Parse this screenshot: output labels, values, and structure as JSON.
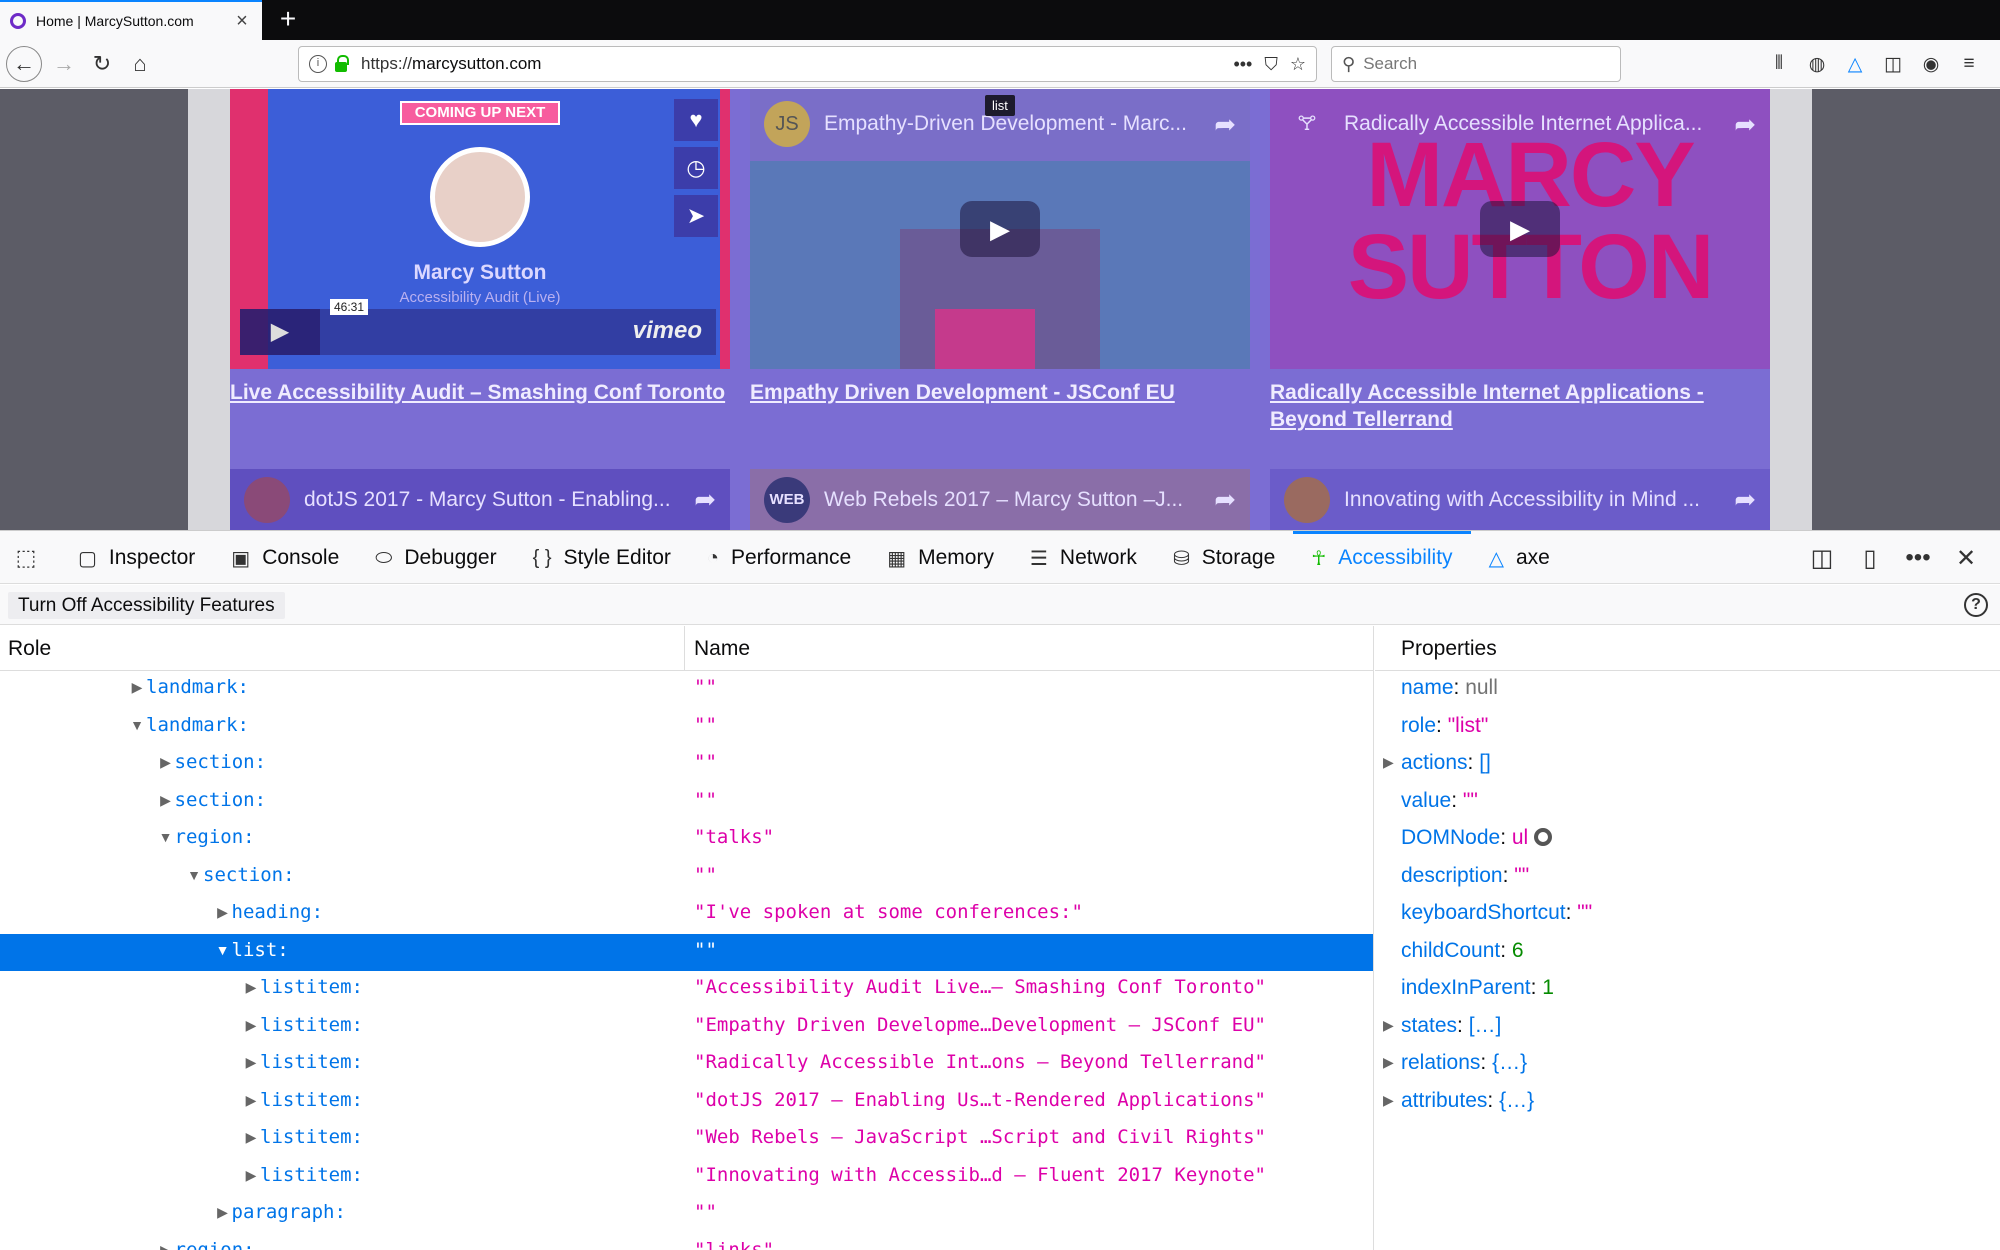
{
  "browser": {
    "tab_title": "Home | MarcySutton.com",
    "new_tab": "+",
    "url_prefix": "https://",
    "url_host": "marcysutton.com",
    "search_placeholder": "Search"
  },
  "page": {
    "tooltip": "list",
    "cards": [
      {
        "badge": "COMING UP NEXT",
        "speaker": "Marcy Sutton",
        "subtitle": "Accessibility Audit (Live)",
        "time": "46:31",
        "player_brand": "vimeo",
        "link": "Live Accessibility Audit – Smashing Conf Toronto"
      },
      {
        "avatar": "JS",
        "video_title": "Empathy-Driven Development - Marc...",
        "link": "Empathy Driven Development - JSConf EU"
      },
      {
        "video_title": "Radically Accessible Internet Applica...",
        "big_text": "MARCY SUTTON",
        "link": "Radically Accessible Internet Applications - Beyond Tellerrand"
      },
      {
        "video_title": "dotJS 2017 - Marcy Sutton - Enabling..."
      },
      {
        "avatar": "WEB",
        "video_title": "Web Rebels 2017 – Marcy Sutton –J..."
      },
      {
        "video_title": "Innovating with Accessibility in Mind ..."
      }
    ]
  },
  "devtools": {
    "tabs": [
      {
        "label": "Inspector",
        "icon": "inspector-icon"
      },
      {
        "label": "Console",
        "icon": "console-icon"
      },
      {
        "label": "Debugger",
        "icon": "debugger-icon"
      },
      {
        "label": "Style Editor",
        "icon": "style-editor-icon"
      },
      {
        "label": "Performance",
        "icon": "performance-icon"
      },
      {
        "label": "Memory",
        "icon": "memory-icon"
      },
      {
        "label": "Network",
        "icon": "network-icon"
      },
      {
        "label": "Storage",
        "icon": "storage-icon"
      },
      {
        "label": "Accessibility",
        "icon": "accessibility-icon"
      },
      {
        "label": "axe",
        "icon": "axe-icon"
      }
    ],
    "active_tab": "Accessibility",
    "toggle_label": "Turn Off Accessibility Features",
    "tree": {
      "col_role": "Role",
      "col_name": "Name",
      "rows": [
        {
          "role": "landmark:",
          "name": "\"\"",
          "depth": 0,
          "state": "collapsed"
        },
        {
          "role": "landmark:",
          "name": "\"\"",
          "depth": 0,
          "state": "expanded"
        },
        {
          "role": "section:",
          "name": "\"\"",
          "depth": 1,
          "state": "collapsed"
        },
        {
          "role": "section:",
          "name": "\"\"",
          "depth": 1,
          "state": "collapsed"
        },
        {
          "role": "region:",
          "name": "\"talks\"",
          "depth": 1,
          "state": "expanded"
        },
        {
          "role": "section:",
          "name": "\"\"",
          "depth": 2,
          "state": "expanded"
        },
        {
          "role": "heading:",
          "name": "\"I've spoken at some conferences:\"",
          "depth": 3,
          "state": "collapsed"
        },
        {
          "role": "list:",
          "name": "\"\"",
          "depth": 3,
          "state": "expanded",
          "selected": true
        },
        {
          "role": "listitem:",
          "name": "\"Accessibility Audit Live…– Smashing Conf Toronto\"",
          "depth": 4,
          "state": "collapsed"
        },
        {
          "role": "listitem:",
          "name": "\"Empathy Driven Developme…Development – JSConf EU\"",
          "depth": 4,
          "state": "collapsed"
        },
        {
          "role": "listitem:",
          "name": "\"Radically Accessible Int…ons – Beyond Tellerrand\"",
          "depth": 4,
          "state": "collapsed"
        },
        {
          "role": "listitem:",
          "name": "\"dotJS 2017 – Enabling Us…t-Rendered Applications\"",
          "depth": 4,
          "state": "collapsed"
        },
        {
          "role": "listitem:",
          "name": "\"Web Rebels – JavaScript …Script and Civil Rights\"",
          "depth": 4,
          "state": "collapsed"
        },
        {
          "role": "listitem:",
          "name": "\"Innovating with Accessib…d – Fluent 2017 Keynote\"",
          "depth": 4,
          "state": "collapsed"
        },
        {
          "role": "paragraph:",
          "name": "\"\"",
          "depth": 3,
          "state": "collapsed"
        },
        {
          "role": "region:",
          "name": "\"links\"",
          "depth": 1,
          "state": "collapsed"
        }
      ]
    },
    "properties": {
      "title": "Properties",
      "rows": [
        {
          "key": "name",
          "value": "null",
          "type": "null"
        },
        {
          "key": "role",
          "value": "\"list\"",
          "type": "str"
        },
        {
          "key": "actions",
          "value": "[]",
          "type": "obj",
          "expandable": true
        },
        {
          "key": "value",
          "value": "\"\"",
          "type": "str"
        },
        {
          "key": "DOMNode",
          "value": "ul",
          "type": "node"
        },
        {
          "key": "description",
          "value": "\"\"",
          "type": "str"
        },
        {
          "key": "keyboardShortcut",
          "value": "\"\"",
          "type": "str"
        },
        {
          "key": "childCount",
          "value": "6",
          "type": "num"
        },
        {
          "key": "indexInParent",
          "value": "1",
          "type": "num"
        },
        {
          "key": "states",
          "value": "[…]",
          "type": "obj",
          "expandable": true
        },
        {
          "key": "relations",
          "value": "{…}",
          "type": "obj",
          "expandable": true
        },
        {
          "key": "attributes",
          "value": "{…}",
          "type": "obj",
          "expandable": true
        }
      ]
    }
  },
  "colors": {
    "accent": "#0a84ff",
    "selected_row": "#0074e8",
    "role_text": "#0074e8",
    "string_value": "#dd00a9",
    "number_value": "#058b00",
    "highlight_overlay": "#6e5fd2"
  }
}
